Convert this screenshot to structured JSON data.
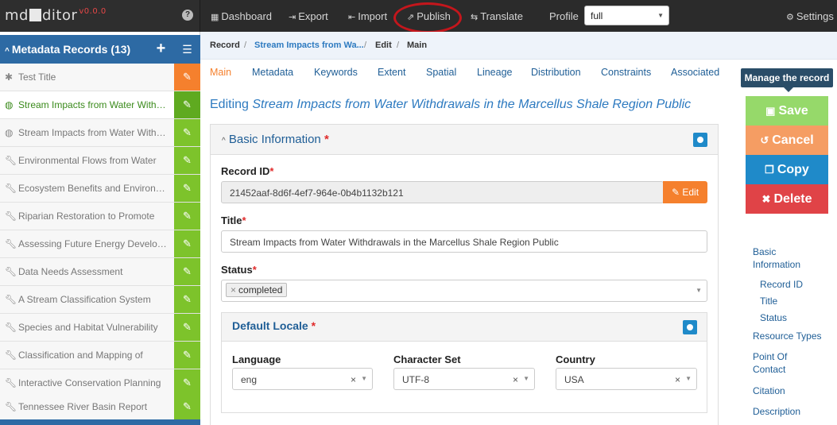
{
  "app": {
    "logo_prefix": "md",
    "logo_suffix": "ditor",
    "version": "v0.0.0",
    "help_icon": "question-circle-icon"
  },
  "topnav": {
    "items": [
      {
        "icon": "dashboard-icon",
        "label": "Dashboard"
      },
      {
        "icon": "export-icon",
        "label": "Export"
      },
      {
        "icon": "import-icon",
        "label": "Import"
      },
      {
        "icon": "publish-icon",
        "label": "Publish"
      },
      {
        "icon": "translate-icon",
        "label": "Translate"
      }
    ],
    "profile_label": "Profile",
    "profile_value": "full",
    "settings_label": "Settings"
  },
  "sidebar": {
    "title": "Metadata Records (13)",
    "add_label": "+",
    "items": [
      {
        "label": "Test Title",
        "icon": "puzzle-icon",
        "state": "first"
      },
      {
        "label": "Stream Impacts from Water Withdrawals",
        "icon": "globe-icon",
        "state": "active"
      },
      {
        "label": "Stream Impacts from Water Withdrawals",
        "icon": "globe-icon",
        "state": ""
      },
      {
        "label": "Environmental Flows from Water",
        "icon": "wrench-icon",
        "state": ""
      },
      {
        "label": "Ecosystem Benefits and Environmental",
        "icon": "wrench-icon",
        "state": ""
      },
      {
        "label": "Riparian Restoration to Promote",
        "icon": "wrench-icon",
        "state": ""
      },
      {
        "label": "Assessing Future Energy Development",
        "icon": "wrench-icon",
        "state": ""
      },
      {
        "label": "Data Needs Assessment",
        "icon": "wrench-icon",
        "state": ""
      },
      {
        "label": "A Stream Classification System",
        "icon": "wrench-icon",
        "state": ""
      },
      {
        "label": "Species and Habitat Vulnerability",
        "icon": "wrench-icon",
        "state": ""
      },
      {
        "label": "Classification and Mapping of",
        "icon": "wrench-icon",
        "state": ""
      },
      {
        "label": "Interactive Conservation Planning",
        "icon": "wrench-icon",
        "state": ""
      },
      {
        "label": "Tennessee River Basin Report",
        "icon": "wrench-icon",
        "state": ""
      }
    ]
  },
  "breadcrumb": {
    "record": "Record",
    "record_title": "Stream Impacts from Wa...",
    "edit": "Edit",
    "main": "Main",
    "sep": "/"
  },
  "tabs": [
    "Main",
    "Metadata",
    "Keywords",
    "Extent",
    "Spatial",
    "Lineage",
    "Distribution",
    "Constraints",
    "Associated"
  ],
  "tooltip": "Manage the record",
  "actions": {
    "save": "Save",
    "cancel": "Cancel",
    "copy": "Copy",
    "delete": "Delete"
  },
  "right_nav": {
    "basic_information_1": "Basic",
    "basic_information_2": "Information",
    "record_id": "Record ID",
    "title": "Title",
    "status": "Status",
    "resource_types": "Resource Types",
    "point_of_contact_1": "Point Of",
    "point_of_contact_2": "Contact",
    "citation": "Citation",
    "description": "Description"
  },
  "main": {
    "editing_prefix": "Editing",
    "editing_title": "Stream Impacts from Water Withdrawals in the Marcellus Shale Region Public",
    "basic_info_title": "Basic Information",
    "record_id_label": "Record ID",
    "record_id_value": "21452aaf-8d6f-4ef7-964e-0b4b1132b121",
    "edit_button": "Edit",
    "title_label": "Title",
    "title_value": "Stream Impacts from Water Withdrawals in the Marcellus Shale Region Public",
    "status_label": "Status",
    "status_value": "completed",
    "default_locale_title": "Default Locale",
    "language_label": "Language",
    "language_value": "eng",
    "charset_label": "Character Set",
    "charset_value": "UTF-8",
    "country_label": "Country",
    "country_value": "USA",
    "required_mark": "*"
  },
  "colors": {
    "sidebar_header": "#2d6aa4",
    "edit_green": "#7dc32b",
    "edit_orange": "#f5802d",
    "save": "#96d96a",
    "cancel": "#f59d63",
    "copy": "#1f8ac9",
    "delete": "#e04347",
    "publish_highlight": "#c4161c"
  }
}
